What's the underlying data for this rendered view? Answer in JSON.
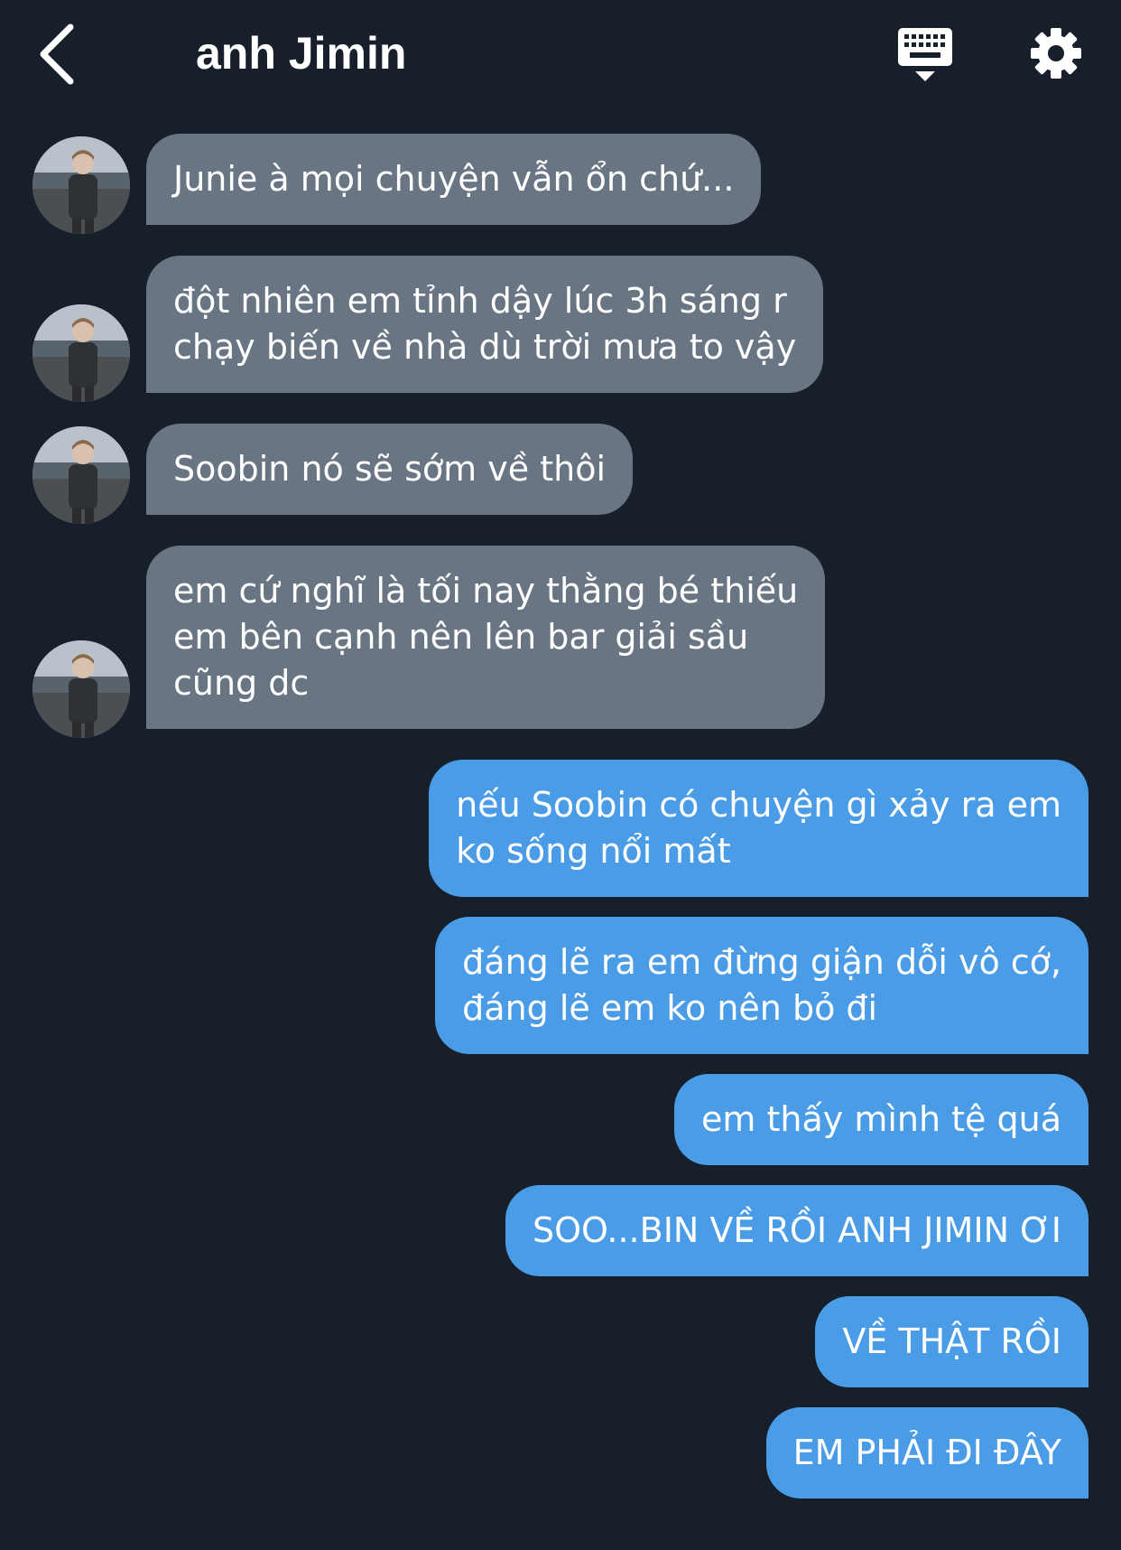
{
  "header": {
    "title": "anh Jimin",
    "back_icon": "chevron-left-icon",
    "keyboard_icon": "keyboard-icon",
    "settings_icon": "gear-icon"
  },
  "colors": {
    "background": "#171f2a",
    "received_bubble": "#697583",
    "sent_bubble": "#4b9ce6",
    "text": "#ffffff"
  },
  "messages": [
    {
      "sender": "contact",
      "lines": [
        "Junie à mọi chuyện vẫn ổn chứ..."
      ]
    },
    {
      "sender": "contact",
      "lines": [
        "đột nhiên em tỉnh dậy lúc 3h sáng r",
        "chạy biến về nhà dù trời mưa to vậy"
      ]
    },
    {
      "sender": "contact",
      "lines": [
        "Soobin nó sẽ sớm về thôi"
      ]
    },
    {
      "sender": "contact",
      "lines": [
        "em cứ nghĩ là tối nay thằng bé thiếu",
        "em bên cạnh nên lên bar giải sầu",
        "cũng dc"
      ]
    },
    {
      "sender": "me",
      "lines": [
        "nếu Soobin có chuyện gì xảy ra em",
        "ko sống nổi mất"
      ]
    },
    {
      "sender": "me",
      "lines": [
        "đáng lẽ ra em đừng giận dỗi vô cớ,",
        "đáng lẽ em ko nên bỏ đi"
      ]
    },
    {
      "sender": "me",
      "lines": [
        "em thấy mình tệ quá"
      ]
    },
    {
      "sender": "me",
      "lines": [
        "SOO...BIN VỀ RỒI ANH JIMIN ƠI"
      ]
    },
    {
      "sender": "me",
      "lines": [
        "VỀ THẬT RỒI"
      ]
    },
    {
      "sender": "me",
      "lines": [
        "EM PHẢI ĐI ĐÂY"
      ]
    }
  ]
}
